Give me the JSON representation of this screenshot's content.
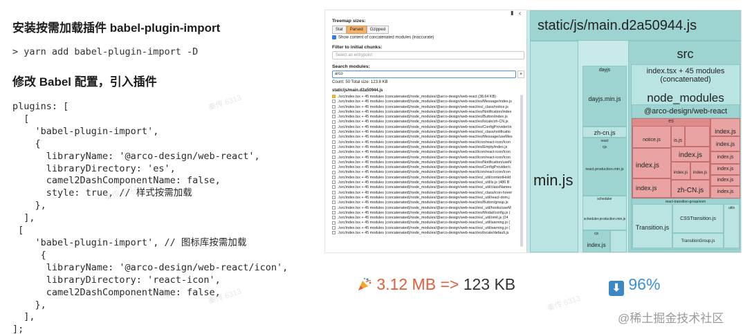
{
  "article": {
    "heading1": "安装按需加载插件 babel-plugin-import",
    "command": "> yarn add babel-plugin-import -D",
    "heading2": "修改 Babel 配置，引入插件",
    "code": "plugins: [\n  [\n    'babel-plugin-import',\n    {\n      libraryName: '@arco-design/web-react',\n      libraryDirectory: 'es',\n      camel2DashComponentName: false,\n      style: true, // 样式按需加载\n    },\n  ],\n [\n    'babel-plugin-import', // 图标库按需加载\n     {\n      libraryName: '@arco-design/web-react/icon',\n      libraryDirectory: 'react-icon',\n      camel2DashComponentName: false,\n    },\n  ],\n];"
  },
  "analyzer": {
    "panel": {
      "treemap_sizes_label": "Treemap sizes:",
      "size_options": [
        "Stat",
        "Parsed",
        "Gzipped"
      ],
      "selected_size": "Parsed",
      "concat_checkbox": "Show content of concatenated modules (inaccurate)",
      "filter_label": "Filter to initial chunks:",
      "select_placeholder": "Select an entrypoint",
      "search_label": "Search modules:",
      "search_value": "arco",
      "search_clear": "×",
      "count_text": "Count: 50    Total size: 123.8 KB",
      "bundle_label": "static/js/main.d2a50944.js",
      "rows": [
        "./src/index.tsx + 45 modules (concatenated)/node_modules/@arco-design/web-react (38.64 KB)",
        "./src/index.tsx + 45 modules (concatenated)/node_modules/@arco-design/web-react/es/Message/index.js",
        "./src/index.tsx + 45 modules (concatenated)/node_modules/@arco-design/web-react/es/_class/notice.js",
        "./src/index.tsx + 45 modules (concatenated)/node_modules/@arco-design/web-react/es/Notification/index",
        "./src/index.tsx + 45 modules (concatenated)/node_modules/@arco-design/web-react/es/Button/index.js",
        "./src/index.tsx + 45 modules (concatenated)/node_modules/@arco-design/web-react/es/locale/zh-CN.js",
        "./src/index.tsx + 45 modules (concatenated)/node_modules/@arco-design/web-react/es/ConfigProvider/in",
        "./src/index.tsx + 45 modules (concatenated)/node_modules/@arco-design/web-react/es/_class/notificatio",
        "./src/index.tsx + 45 modules (concatenated)/node_modules/@arco-design/web-react/es/Message/useMes",
        "./src/index.tsx + 45 modules (concatenated)/node_modules/@arco-design/web-react/icon/react-icon/Icon",
        "./src/index.tsx + 45 modules (concatenated)/node_modules/@arco-design/web-react/es/Empty/index.js",
        "./src/index.tsx + 45 modules (concatenated)/node_modules/@arco-design/web-react/icon/react-icon/Icon",
        "./src/index.tsx + 45 modules (concatenated)/node_modules/@arco-design/web-react/icon/react-icon/Icon",
        "./src/index.tsx + 45 modules (concatenated)/node_modules/@arco-design/web-react/es/Notification/useN",
        "./src/index.tsx + 45 modules (concatenated)/node_modules/@arco-design/web-react/es/ConfigProvider/c",
        "./src/index.tsx + 45 modules (concatenated)/node_modules/@arco-design/web-react/icon/react-icon/Icon",
        "./src/index.tsx + 45 modules (concatenated)/node_modules/@arco-design/web-react/es/_util/contextHold",
        "./src/index.tsx + 45 modules (concatenated)/node_modules/@arco-design/web-react/es/_util/is.js (486 B",
        "./src/index.tsx + 45 modules (concatenated)/node_modules/@arco-design/web-react/es/_util/classNames",
        "./src/index.tsx + 45 modules (concatenated)/node_modules/@arco-design/web-react/es/_class/icon-hover",
        "./src/index.tsx + 45 modules (concatenated)/node_modules/@arco-design/web-react/es/_util/react-dom.j",
        "./src/index.tsx + 45 modules (concatenated)/node_modules/@arco-design/web-react/es/Button/group.js",
        "./src/index.tsx + 45 modules (concatenated)/node_modules/@arco-design/web-react/es/_util/hooks/useM",
        "./src/index.tsx + 45 modules (concatenated)/node_modules/@arco-design/web-react/es/Modal/config.js (",
        "./src/index.tsx + 45 modules (concatenated)/node_modules/@arco-design/web-react/es/_util/omit.js (24",
        "./src/index.tsx + 45 modules (concatenated)/node_modules/@arco-design/web-react/es/_util/warning.js (",
        "./src/index.tsx + 45 modules (concatenated)/node_modules/@arco-design/web-react/es/_util/warning.js (",
        "./src/index.tsx + 45 modules (concatenated)/node_modules/@arco-design/web-react/es/locale/default.js"
      ]
    },
    "treemap": {
      "bundle_title": "static/js/main.d2a50944.js",
      "main_fragment": "min.js",
      "dayjs_header": "dayjs",
      "dayjs_min": "dayjs.min.js",
      "zh_cn": "zh-cn.js",
      "react_label": "react",
      "cjs_label": "cjs",
      "react_prod": "react.production.min.js",
      "scheduler": "scheduler",
      "scheduler_prod": "scheduler.production.min.js",
      "cjs_small": "cjs",
      "index_small": "index.js",
      "src": "src",
      "index_tsx": "index.tsx + 45 modules\n(concatenated)",
      "node_modules": "node_modules",
      "arco": "@arco-design/web-react",
      "es": "es",
      "notice": "notice.js",
      "is": "is.js",
      "index_js": "index.js",
      "zh_CN": "zh-CN.js",
      "react_tg": "react-transition-group/esm",
      "transition": "Transition.js",
      "css_transition": "CSSTransition.js",
      "transition_group": "TransitionGroup.js",
      "utils": "utils"
    }
  },
  "stats": {
    "before": "3.12 MB",
    "arrow": "=>",
    "after": "123 KB",
    "percent": "96%",
    "down_icon": "⬇",
    "before_color": "#e35d3a",
    "after_color": "#333333",
    "percent_color": "#3a8fd9"
  },
  "footer": "@稀土掘金技术社区",
  "watermark_text": "秦传 6313"
}
